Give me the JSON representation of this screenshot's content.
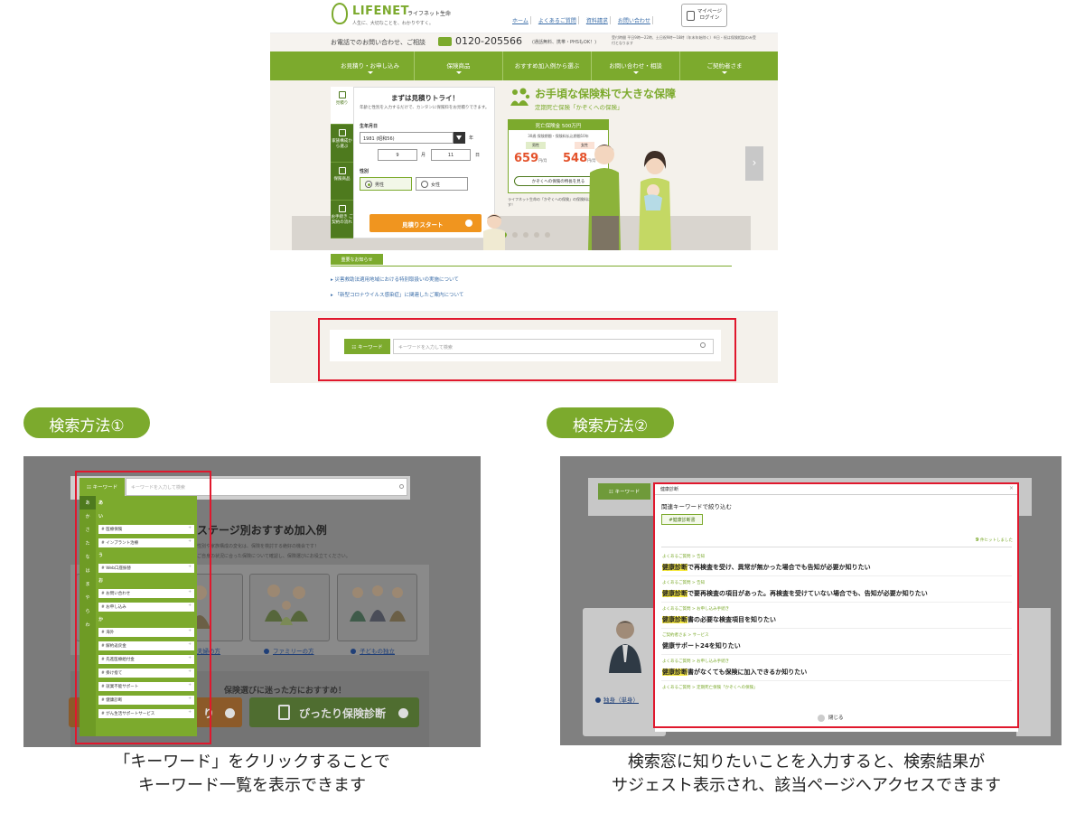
{
  "site": {
    "logo_text": "LIFENET",
    "logo_jp": "ライフネット生命",
    "tagline": "人生に、大切なことを、わかりやすく。",
    "top_links": [
      "ホーム",
      "よくあるご質問",
      "資料請求",
      "お問い合わせ"
    ],
    "mypage_label": "マイページ\nログイン",
    "phone_lead": "お電話でのお問い合わせ、ご相談",
    "phone_number": "0120-205566",
    "phone_note": "(通話無料、携帯・PHSもOK！)",
    "phone_hours": "受付時間 平日9時〜22時、土日祝9時〜18時（年末年始除く）※日・祝は保険相談のみ受付となります",
    "nav": [
      "お見積り・お申し込み",
      "保険商品",
      "おすすめ加入例から選ぶ",
      "お問い合わせ・相談",
      "ご契約者さま"
    ]
  },
  "quote": {
    "tabs": [
      "見積り",
      "家族構成から選ぶ",
      "保険商品",
      "お手続き ご契約の流れ"
    ],
    "title": "まずは見積りトライ！",
    "desc": "年齢と性別を入力するだけで、カンタンに保険料をお見積りできます。",
    "dob_label": "生年月日",
    "year_value": "1981 (昭和56)",
    "year_unit": "年",
    "month_value": "9",
    "month_unit": "月",
    "day_value": "11",
    "day_unit": "日",
    "sex_label": "性別",
    "male": "男性",
    "female": "女性",
    "start_button": "見積りスタート"
  },
  "promo": {
    "title": "お手頃な保険料で大きな保障",
    "subtitle": "定期死亡保険「かぞくへの保険」",
    "card_head": "死亡保険金 500万円",
    "card_cond": "30歳 保険期間・保険料払込期間10年",
    "male_tag": "男性",
    "female_tag": "女性",
    "male_price": "659",
    "female_price": "548",
    "price_unit": "円/月",
    "feature_button": "かぞくへの保険の特長を見る",
    "note": "ライフネット生命の「かぞくへの保険」の保険料は業界最安水準です！",
    "next_arrow": "›"
  },
  "news": {
    "tag": "重要なお知らせ",
    "items": [
      "災害救助法適用地域における特別取扱いの実施について",
      "「新型コロナウイルス感染症」に関連したご案内について"
    ]
  },
  "search": {
    "keyword_button": "☷ キーワード",
    "placeholder": "キーワードを入力して検索"
  },
  "method1": {
    "pill": "検索方法①",
    "keyword_button": "☷ キーワード",
    "placeholder": "キーワードを入力して検索",
    "heading": "ステージ別おすすめ加入例",
    "desc1": "性別や家族構成の変化は、保険を検討する絶好の機会です！",
    "desc2": "ご自身の状況に合った保険について確認し、保険選びにお役立てください。",
    "links": [
      "夫婦の方",
      "ファミリーの方",
      "子どもの独立"
    ],
    "guide": "保険選びに迷った方におすすめ！",
    "orange_tail": "り",
    "green_button": "ぴったり保険診断",
    "index": [
      "あ",
      "か",
      "さ",
      "た",
      "な",
      "は",
      "ま",
      "や",
      "ら",
      "わ"
    ],
    "groups": [
      {
        "label": "あ",
        "items": []
      },
      {
        "label": "い",
        "items": [
          "# 医療保険",
          "# インプラント治療"
        ]
      },
      {
        "label": "う",
        "items": [
          "# Web口座振替"
        ]
      },
      {
        "label": "お",
        "items": [
          "# お問い合わせ",
          "# お申し込み"
        ]
      },
      {
        "label": "か",
        "items": [
          "# 海外",
          "# 解約返戻金",
          "# 先進医療給付金",
          "# 掛け捨て",
          "# 就業不能サポート",
          "# 健康診断",
          "# がん生活サポートサービス"
        ]
      }
    ],
    "caption1": "「キーワード」をクリックすることで",
    "caption2": "キーワード一覧を表示できます"
  },
  "method2": {
    "pill": "検索方法②",
    "keyword_button": "☷ キーワード",
    "input_value": "健康診断",
    "close_x": "×",
    "related_label": "関連キーワードで絞り込む",
    "tag": "#健康診断書",
    "hits_count": "9",
    "hits_suffix": "件ヒットしました",
    "results": [
      {
        "category": "よくあるご質問 > 告知",
        "highlight": "健康診断",
        "rest": "で再検査を受け、異常が無かった場合でも告知が必要か知りたい"
      },
      {
        "category": "よくあるご質問 > 告知",
        "highlight": "健康診断",
        "rest": "で要再検査の項目があった。再検査を受けていない場合でも、告知が必要か知りたい"
      },
      {
        "category": "よくあるご質問 > お申し込み手続き",
        "highlight": "健康診断",
        "rest": "書の必要な検査項目を知りたい"
      },
      {
        "category": "ご契約者さま > サービス",
        "highlight": "",
        "rest": "健康サポート24を知りたい"
      },
      {
        "category": "よくあるご質問 > お申し込み手続き",
        "highlight": "健康診断",
        "rest": "書がなくても保険に加入できるか知りたい"
      },
      {
        "category": "よくあるご質問 > 定期死亡保険「かぞくへの保険」",
        "highlight": "",
        "rest": ""
      }
    ],
    "close_button": "閉じる",
    "side_link": "独身（単身）",
    "caption1": "検索窓に知りたいことを入力すると、検索結果が",
    "caption2": "サジェスト表示され、該当ページへアクセスできます"
  },
  "colors": {
    "brand_green": "#7caa2d",
    "dark_green": "#4e7a1e",
    "highlight_red": "#e0182d",
    "price_red": "#e4532c",
    "cta_orange": "#f0951f"
  }
}
